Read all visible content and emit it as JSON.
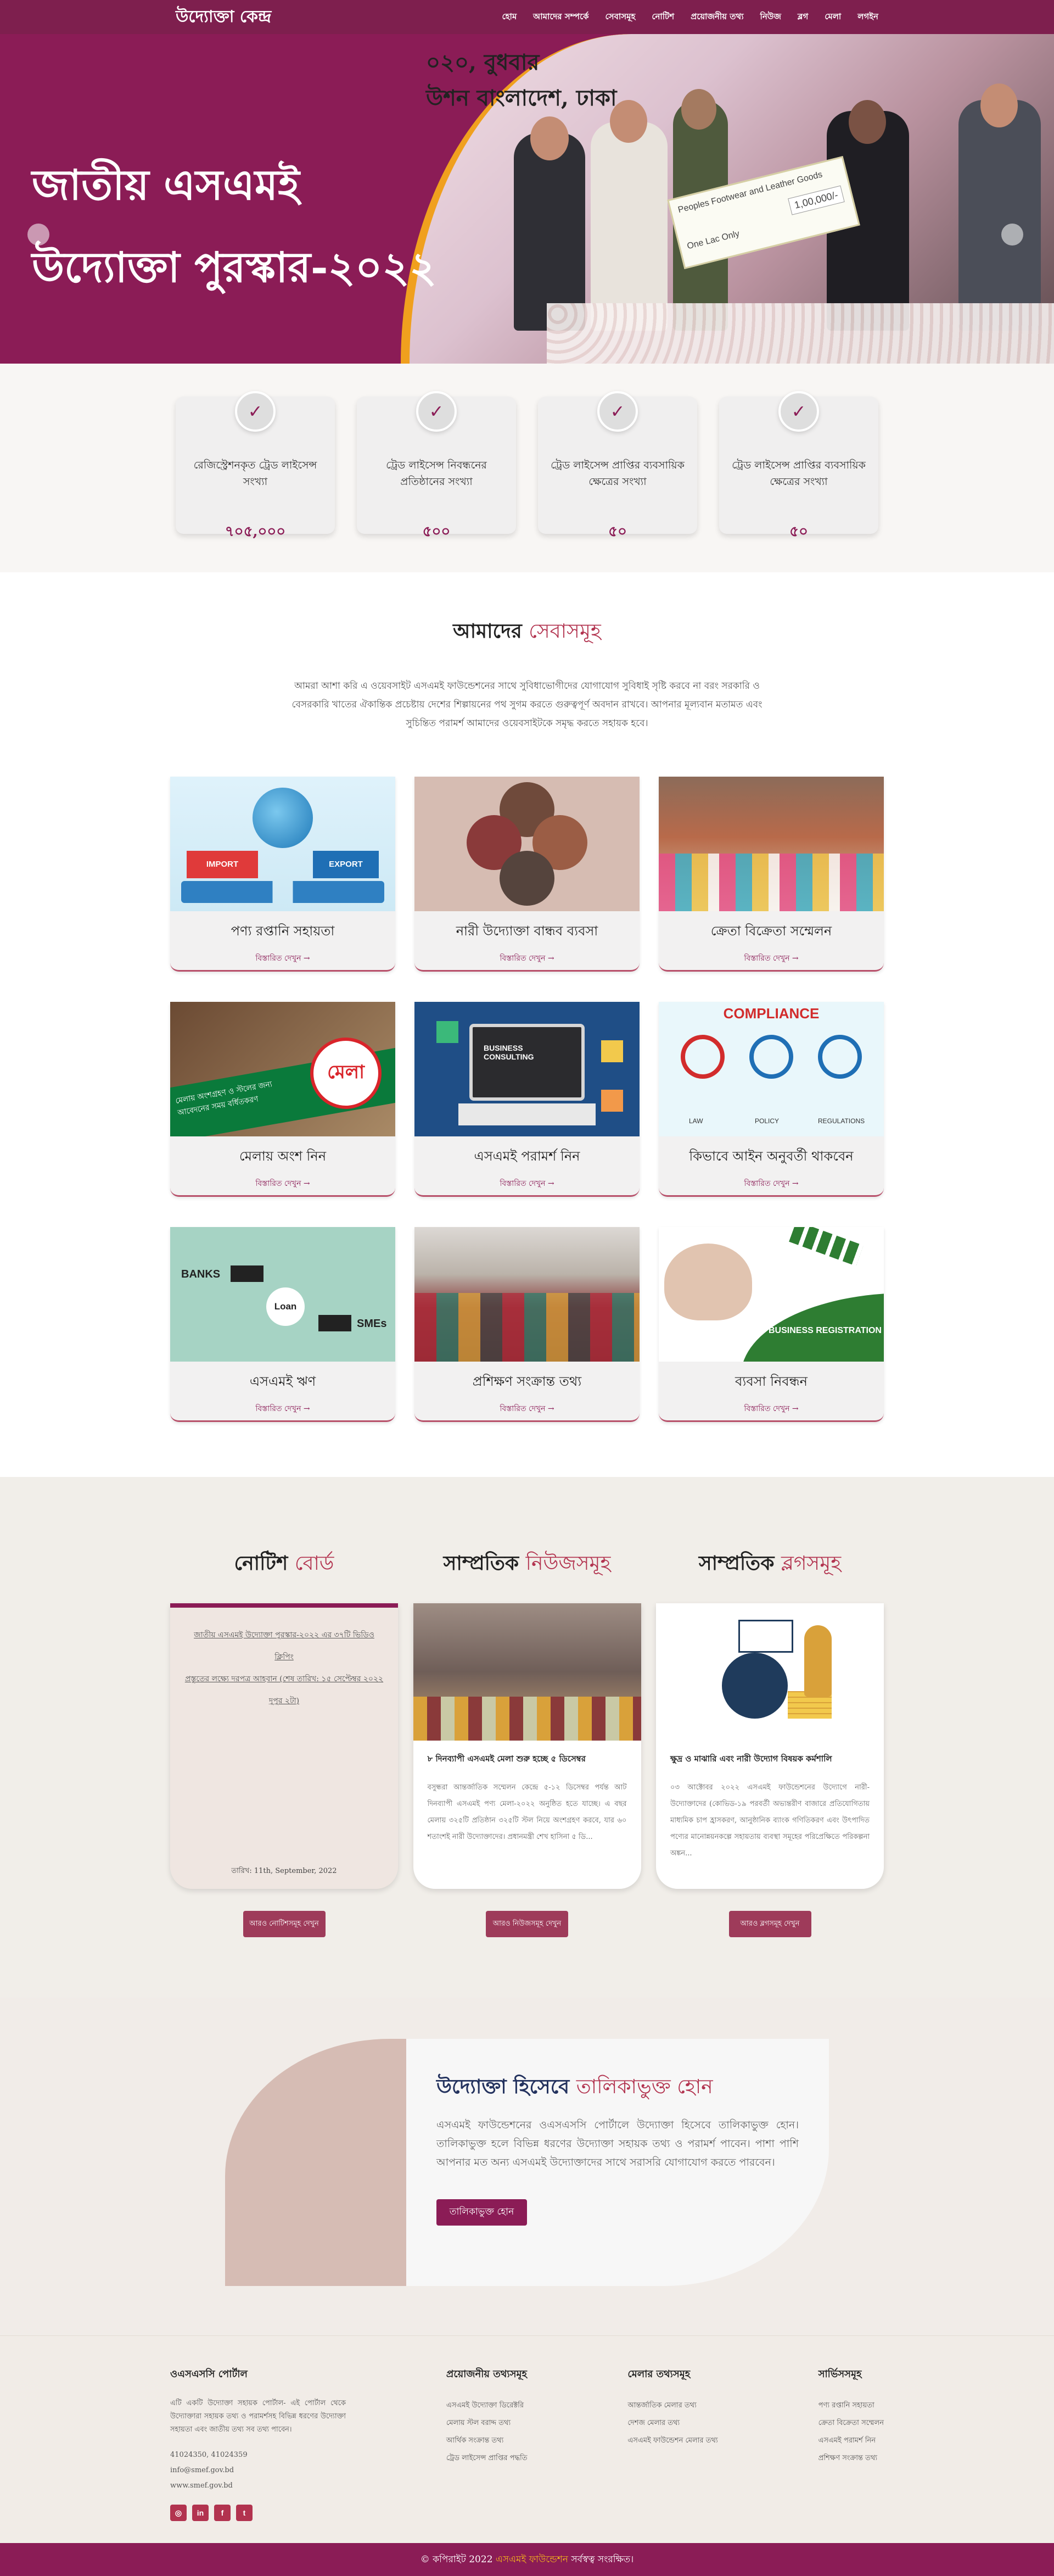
{
  "nav": {
    "brand": "উদ্যোক্তা কেন্দ্র",
    "items": [
      "হোম",
      "আমাদের সম্পর্কে",
      "সেবাসমূহ",
      "নোটিশ",
      "প্রয়োজনীয় তথ্য",
      "নিউজ",
      "ব্লগ",
      "মেলা",
      "লগইন"
    ]
  },
  "hero": {
    "title_line1": "জাতীয় এসএমই",
    "title_line2": "উদ্যোক্তা পুরস্কার-২০২২",
    "photo_caption_line1": "০২০, বুধবার",
    "photo_caption_line2": "উশন বাংলাদেশ, ঢাকা",
    "cheque_text": "Peoples Footwear and Leather Goods",
    "cheque_amount": "1,00,000/-",
    "cheque_words": "One Lac Only"
  },
  "stats": [
    {
      "label": "রেজিস্ট্রেশনকৃত ট্রেড লাইসেন্স সংখ্যা",
      "value": "৭০৫,০০০"
    },
    {
      "label": "ট্রেড লাইসেন্স নিবন্ধনের প্রতিষ্ঠানের সংখ্যা",
      "value": "৫০০"
    },
    {
      "label": "ট্রেড লাইসেন্স প্রাপ্তির ব্যবসায়িক ক্ষেত্রের সংখ্যা",
      "value": "৫০"
    },
    {
      "label": "ট্রেড লাইসেন্স প্রাপ্তির ব্যবসায়িক ক্ষেত্রের সংখ্যা",
      "value": "৫০"
    }
  ],
  "services": {
    "title": "আমাদের",
    "title_accent": "সেবাসমূহ",
    "intro": "আমরা আশা করি এ ওয়েবসাইট এসএমই ফাউন্ডেশনের সাথে সুবিধাভোগীদের যোগাযোগ সুবিধাই সৃষ্টি করবে না বরং সরকারি ও বেসরকারি খাতের ঐকান্তিক প্রচেষ্টায় দেশের শিল্পায়নের পথ সুগম করতে গুরুত্বপূর্ণ অবদান রাখবে। আপনার মূল্যবান মতামত এবং সুচিন্তিত পরামর্শ আমাদের ওয়েবসাইটকে সমৃদ্ধ করতে সহায়ক হবে।",
    "more_label": "বিস্তারিত দেখুন →",
    "items": [
      {
        "title": "পণ্য রপ্তানি সহায়তা",
        "img": "import-export",
        "img_text_a": "IMPORT",
        "img_text_b": "EXPORT"
      },
      {
        "title": "নারী উদ্যোক্তা বান্ধব ব্যবসা",
        "img": "women-collage"
      },
      {
        "title": "ক্রেতা বিক্রেতা সম্মেলন",
        "img": "buyer-seller"
      },
      {
        "title": "মেলায় অংশ নিন",
        "img": "fair-poster",
        "img_text_a": "মেলা",
        "img_text_b": "মেলায় অংশগ্রহণ ও স্টলের জন্য আবেদনের সময় বর্ধিতকরণ"
      },
      {
        "title": "এসএমই পরামর্শ নিন",
        "img": "consulting",
        "img_text_a": "BUSINESS CONSULTING"
      },
      {
        "title": "কিভাবে আইন অনুবর্তী থাকবেন",
        "img": "compliance",
        "img_text_a": "COMPLIANCE",
        "img_text_b": "LAW",
        "img_text_c": "POLICY",
        "img_text_d": "REGULATIONS"
      },
      {
        "title": "এসএমই ঋণ",
        "img": "loan",
        "img_text_a": "BANKS",
        "img_text_b": "Loan",
        "img_text_c": "SMEs"
      },
      {
        "title": "প্রশিক্ষণ সংক্রান্ত তথ্য",
        "img": "training"
      },
      {
        "title": "ব্যবসা নিবন্ধন",
        "img": "registration",
        "img_text_a": "BUSINESS REGISTRATION"
      }
    ]
  },
  "highlights": {
    "notice": {
      "title": "নোটিশ",
      "title_accent": "বোর্ড",
      "lines": [
        "জাতীয় এসএমই উদ্যোক্তা পুরস্কার-২০২২ এর ৩৭টি ভিডিও ক্লিপিং",
        "প্রস্তুতের লক্ষ্যে দরপত্র আহবান (শেষ তারিখ: ১৫ সেপ্টেম্বর ২০২২",
        "দুপুর ২টা)"
      ],
      "date": "তারিখ: 11th, September, 2022",
      "button": "আরও নোটিশসমূহ দেখুন"
    },
    "news": {
      "title": "সাম্প্রতিক",
      "title_accent": "নিউজসমূহ",
      "item_title": "৮ দিনব্যাপী এসএমই মেলা শুরু হচ্ছে ৫ ডিসেম্বর",
      "item_desc": "বসুন্ধরা আন্তর্জাতিক সম্মেলন কেন্দ্রে ৫-১২ ডিসেম্বর পর্যন্ত আট দিনব্যাপী এসএমই পণ্য মেলা-২০২২ অনুষ্ঠিত হতে যাচ্ছে। এ বছর মেলায় ৩২৫টি প্রতিষ্ঠান ৩২৫টি স্টল নিয়ে অংশগ্রহণ করবে, যার ৬০ শতাংশই নারী উদ্যোক্তাদের। প্রধানমন্ত্রী শেখ হাসিনা ৫ ডি...",
      "button": "আরও নিউজসমূহ দেখুন"
    },
    "blog": {
      "title": "সাম্প্রতিক",
      "title_accent": "ব্লগসমূহ",
      "item_title": "ক্ষুদ্র ও মাঝারি এবং নারী উদ্যোগ বিষয়ক কর্মশালি",
      "item_desc": "০৩ আক্টোবর ২০২২ এসএমই ফাউন্ডেশনের উদ্যোগে নারী-উদ্যোক্তাদের (কোভিড-১৯ পরবর্তী অভ্যন্তরীণ বাজারে প্রতিযোগিতায় মাধ্যমিক চাপ হ্রাসকরণ, আনুষ্ঠানিক ব্যাংক গণিতিকরণ এবং উৎপাদিত পণ্যের মানোন্নয়নকল্পে সহায়তায় ব্যবস্থা সমূহের পরিপ্রেক্ষিতে পরিকল্পনা অঙ্কন...",
      "button": "আরও ব্লগসমূহ দেখুন"
    }
  },
  "cta": {
    "title": "উদ্যোক্তা হিসেবে",
    "title_accent": "তালিকাভুক্ত হোন",
    "text": "এসএমই ফাউন্ডেশনের ওএসএসসি পোর্টালে উদ্যোক্তা হিসেবে তালিকাভুক্ত হোন। তালিকাভুক্ত হলে বিভিন্ন ধরণের উদ্যোক্তা সহায়ক তথ্য ও পরামর্শ পাবেন। পাশা পাশি আপনার মত অন্য এসএমই উদ্যোক্তাদের সাথে সরাসরি যোগাযোগ করতে পারবেন।",
    "button": "তালিকাভুক্ত হোন"
  },
  "footer": {
    "col1": {
      "title": "ওএসএসসি পোর্টাল",
      "about": "এটি একটি উদ্যোক্তা সহায়ক পোর্টাল- এই পোর্টাল থেকে উদ্যোক্তারা সহায়ক তথ্য ও পরামর্শসহ বিভিন্ন ধরণের উদ্যোক্তা সহায়তা এবং জাতীয় তথ্য সব তথ্য পাবেন।",
      "phone": "41024350, 41024359",
      "email": "info@smef.gov.bd",
      "web": "www.smef.gov.bd",
      "socials": [
        "◎",
        "in",
        "f",
        "t"
      ]
    },
    "col2": {
      "title": "প্রয়োজনীয় তথ্যসমূহ",
      "items": [
        "এসএমই উদ্যোক্তা ডিরেক্টরি",
        "মেলায় স্টল বরাদ্দ তথ্য",
        "আর্থিক সংক্রান্ত তথ্য",
        "ট্রেড লাইসেন্স প্রাপ্তির পদ্ধতি"
      ]
    },
    "col3": {
      "title": "মেলার তথ্যসমূহ",
      "items": [
        "আন্তর্জাতিক মেলার তথ্য",
        "দেশজ মেলার তথ্য",
        "এসএমই ফাউন্ডেশন মেলার তথ্য"
      ]
    },
    "col4": {
      "title": "সার্ভিসসমূহ",
      "items": [
        "পণ্য রপ্তানি সহায়তা",
        "ক্রেতা বিক্রেতা সম্মেলন",
        "এসএমই পরামর্শ নিন",
        "প্রশিক্ষণ সংক্রান্ত তথ্য"
      ]
    }
  },
  "copyright": {
    "prefix": "© কপিরাইট 2022",
    "org": "এসএমই ফাউন্ডেশন",
    "suffix": "সর্বস্বত্ব সংরক্ষিত।"
  },
  "colors": {
    "primary": "#8b1c56",
    "accent": "#b2334f",
    "gold": "#f0a01e"
  }
}
